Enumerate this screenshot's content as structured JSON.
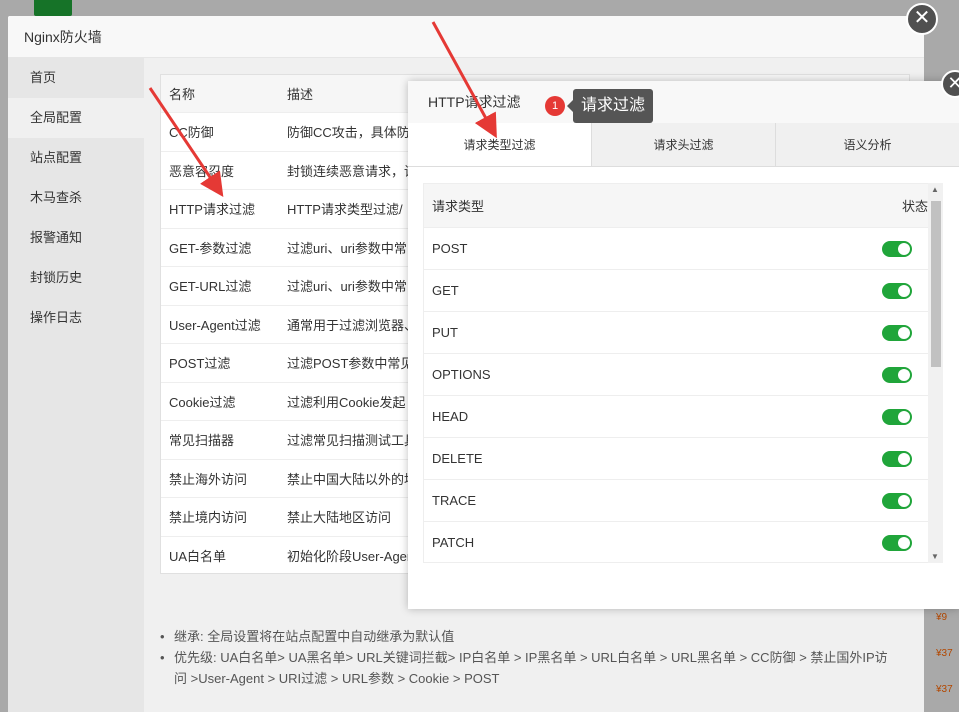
{
  "outer": {
    "title": "Nginx防火墙",
    "close": "✕",
    "nav": [
      "首页",
      "全局配置",
      "站点配置",
      "木马查杀",
      "报警通知",
      "封锁历史",
      "操作日志"
    ],
    "table": {
      "headers": [
        "名称",
        "描述"
      ],
      "rows": [
        [
          "CC防御",
          "防御CC攻击，具体防"
        ],
        [
          "恶意容忍度",
          "封锁连续恶意请求，请"
        ],
        [
          "HTTP请求过滤",
          "HTTP请求类型过滤/"
        ],
        [
          "GET-参数过滤",
          "过滤uri、uri参数中常"
        ],
        [
          "GET-URL过滤",
          "过滤uri、uri参数中常"
        ],
        [
          "User-Agent过滤",
          "通常用于过滤浏览器、"
        ],
        [
          "POST过滤",
          "过滤POST参数中常见"
        ],
        [
          "Cookie过滤",
          "过滤利用Cookie发起"
        ],
        [
          "常见扫描器",
          "过滤常见扫描测试工具"
        ],
        [
          "禁止海外访问",
          "禁止中国大陆以外的地"
        ],
        [
          "禁止境内访问",
          "禁止大陆地区访问"
        ],
        [
          "UA白名单",
          "初始化阶段User-Agen"
        ]
      ]
    },
    "tips": [
      "继承: 全局设置将在站点配置中自动继承为默认值",
      "优先级: UA白名单> UA黑名单> URL关键词拦截> IP白名单 > IP黑名单 > URL白名单 > URL黑名单 > CC防御 > 禁止国外IP访问 >User-Agent > URI过滤 > URL参数 > Cookie > POST"
    ]
  },
  "inner": {
    "title": "HTTP请求过滤",
    "close": "✕",
    "tabs": [
      "请求类型过滤",
      "请求头过滤",
      "语义分析"
    ],
    "list_header": {
      "type": "请求类型",
      "status": "状态"
    },
    "methods": [
      {
        "name": "POST",
        "enabled": true
      },
      {
        "name": "GET",
        "enabled": true
      },
      {
        "name": "PUT",
        "enabled": true
      },
      {
        "name": "OPTIONS",
        "enabled": true
      },
      {
        "name": "HEAD",
        "enabled": true
      },
      {
        "name": "DELETE",
        "enabled": true
      },
      {
        "name": "TRACE",
        "enabled": true
      },
      {
        "name": "PATCH",
        "enabled": true
      }
    ]
  },
  "annotation": {
    "badge": "1",
    "tooltip": "请求过滤"
  },
  "background": {
    "prices": [
      "¥9",
      "¥37",
      "¥37"
    ]
  },
  "colors": {
    "accent": "#20a53a",
    "arrow": "#e53935"
  }
}
